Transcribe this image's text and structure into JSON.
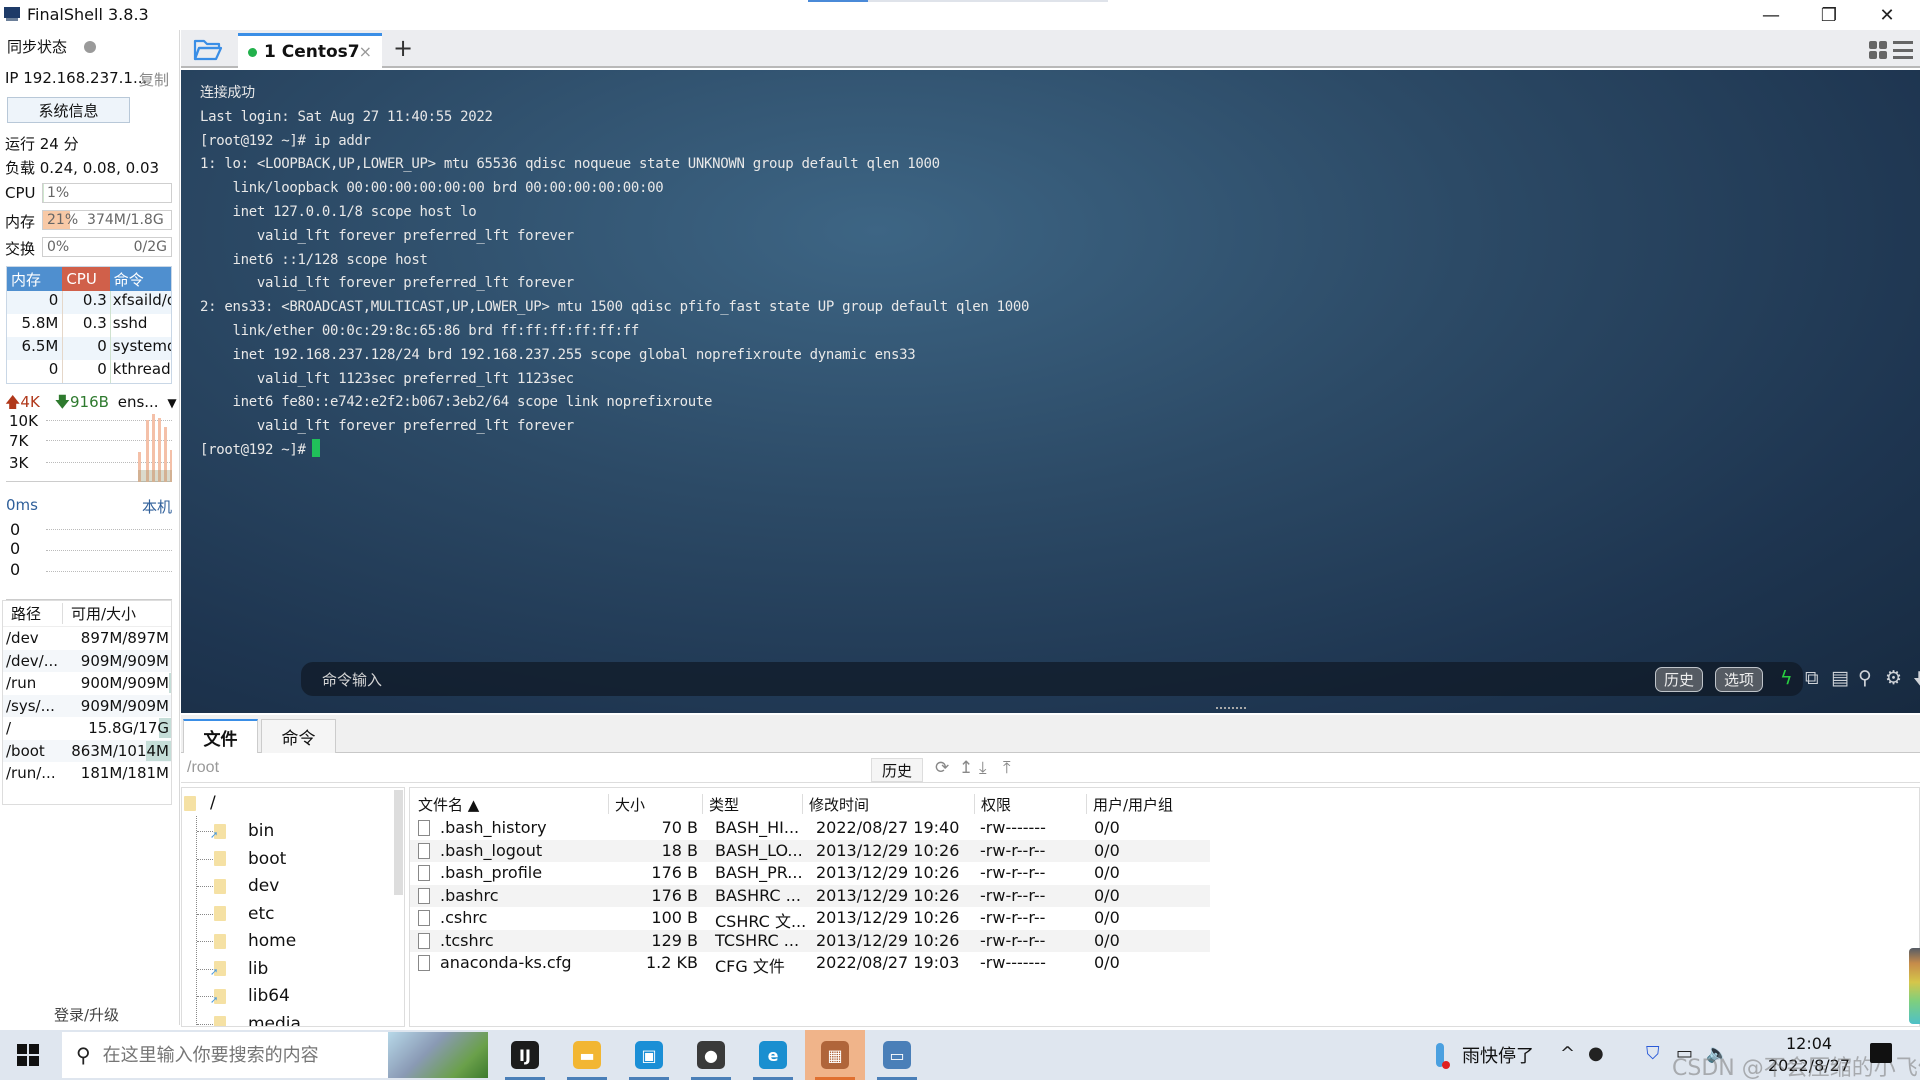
{
  "window": {
    "title": "FinalShell 3.8.3",
    "controls": {
      "minimize": "—",
      "maximize": "❐",
      "close": "✕"
    }
  },
  "sidebar": {
    "sync_label": "同步状态",
    "ip_label": "IP 192.168.237.1...",
    "copy_label": "复制",
    "sysinfo_button": "系统信息",
    "uptime": "运行 24 分",
    "load": "负载 0.24, 0.08, 0.03",
    "cpu": {
      "label": "CPU",
      "value": "1%",
      "percent": 1
    },
    "memory": {
      "label": "内存",
      "value": "21%",
      "detail": "374M/1.8G",
      "percent": 21
    },
    "swap": {
      "label": "交换",
      "value": "0%",
      "detail": "0/2G",
      "percent": 0
    },
    "process_table": {
      "headers": {
        "mem": "内存",
        "cpu": "CPU",
        "cmd": "命令"
      },
      "header_colors": {
        "mem": "#4f8fcf",
        "cpu": "#d0604a",
        "cmd": "#4f8fcf"
      },
      "rows": [
        {
          "mem": "0",
          "cpu": "0.3",
          "cmd": "xfsaild/d"
        },
        {
          "mem": "5.8M",
          "cpu": "0.3",
          "cmd": "sshd"
        },
        {
          "mem": "6.5M",
          "cpu": "0",
          "cmd": "systemd"
        },
        {
          "mem": "0",
          "cpu": "0",
          "cmd": "kthreadd"
        }
      ]
    },
    "network": {
      "upload": "4K",
      "download": "916B",
      "interface": "ens...",
      "ticks": [
        "10K",
        "7K",
        "3K"
      ]
    },
    "ping": {
      "latency": "0ms",
      "host": "本机",
      "values": [
        "0",
        "0",
        "0"
      ]
    },
    "disks": {
      "headers": {
        "path": "路径",
        "size": "可用/大小"
      },
      "rows": [
        {
          "path": "/dev",
          "size": "897M/897M",
          "used_percent": 0
        },
        {
          "path": "/dev/...",
          "size": "909M/909M",
          "used_percent": 0
        },
        {
          "path": "/run",
          "size": "900M/909M",
          "used_percent": 1
        },
        {
          "path": "/sys/...",
          "size": "909M/909M",
          "used_percent": 0
        },
        {
          "path": "/",
          "size": "15.8G/17G",
          "used_percent": 7
        },
        {
          "path": "/boot",
          "size": "863M/1014M",
          "used_percent": 15
        },
        {
          "path": "/run/...",
          "size": "181M/181M",
          "used_percent": 0
        }
      ]
    },
    "login_upgrade": "登录/升级"
  },
  "tabs": {
    "session": {
      "label": "1 Centos7",
      "status_color": "#22b14c",
      "close": "×"
    },
    "add": "+"
  },
  "terminal": {
    "lines": [
      "连接成功",
      "Last login: Sat Aug 27 11:40:55 2022",
      "[root@192 ~]# ip addr",
      "1: lo: <LOOPBACK,UP,LOWER_UP> mtu 65536 qdisc noqueue state UNKNOWN group default qlen 1000",
      "    link/loopback 00:00:00:00:00:00 brd 00:00:00:00:00:00",
      "    inet 127.0.0.1/8 scope host lo",
      "       valid_lft forever preferred_lft forever",
      "    inet6 ::1/128 scope host",
      "       valid_lft forever preferred_lft forever",
      "2: ens33: <BROADCAST,MULTICAST,UP,LOWER_UP> mtu 1500 qdisc pfifo_fast state UP group default qlen 1000",
      "    link/ether 00:0c:29:8c:65:86 brd ff:ff:ff:ff:ff:ff",
      "    inet 192.168.237.128/24 brd 192.168.237.255 scope global noprefixroute dynamic ens33",
      "       valid_lft 1123sec preferred_lft 1123sec",
      "    inet6 fe80::e742:e2f2:b067:3eb2/64 scope link noprefixroute",
      "       valid_lft forever preferred_lft forever"
    ],
    "prompt": "[root@192 ~]#",
    "command_input_placeholder": "命令输入",
    "history_button": "历史",
    "options_button": "选项"
  },
  "bottom_panel": {
    "tabs": [
      "文件",
      "命令"
    ],
    "path": "/root",
    "history_button": "历史",
    "tree": {
      "root": "/",
      "items": [
        {
          "name": "bin",
          "symlink": true
        },
        {
          "name": "boot",
          "symlink": false
        },
        {
          "name": "dev",
          "symlink": false
        },
        {
          "name": "etc",
          "symlink": false
        },
        {
          "name": "home",
          "symlink": false
        },
        {
          "name": "lib",
          "symlink": true
        },
        {
          "name": "lib64",
          "symlink": true
        },
        {
          "name": "media",
          "symlink": false
        }
      ]
    },
    "file_headers": {
      "name": "文件名 ▲",
      "size": "大小",
      "type": "类型",
      "modified": "修改时间",
      "perms": "权限",
      "owner": "用户/用户组"
    },
    "files": [
      {
        "name": ".bash_history",
        "size": "70 B",
        "type": "BASH_HI...",
        "modified": "2022/08/27 19:40",
        "perms": "-rw-------",
        "owner": "0/0"
      },
      {
        "name": ".bash_logout",
        "size": "18 B",
        "type": "BASH_LO...",
        "modified": "2013/12/29 10:26",
        "perms": "-rw-r--r--",
        "owner": "0/0"
      },
      {
        "name": ".bash_profile",
        "size": "176 B",
        "type": "BASH_PR...",
        "modified": "2013/12/29 10:26",
        "perms": "-rw-r--r--",
        "owner": "0/0"
      },
      {
        "name": ".bashrc",
        "size": "176 B",
        "type": "BASHRC ...",
        "modified": "2013/12/29 10:26",
        "perms": "-rw-r--r--",
        "owner": "0/0"
      },
      {
        "name": ".cshrc",
        "size": "100 B",
        "type": "CSHRC 文...",
        "modified": "2013/12/29 10:26",
        "perms": "-rw-r--r--",
        "owner": "0/0"
      },
      {
        "name": ".tcshrc",
        "size": "129 B",
        "type": "TCSHRC ...",
        "modified": "2013/12/29 10:26",
        "perms": "-rw-r--r--",
        "owner": "0/0"
      },
      {
        "name": "anaconda-ks.cfg",
        "size": "1.2 KB",
        "type": "CFG 文件",
        "modified": "2022/08/27 19:03",
        "perms": "-rw-------",
        "owner": "0/0"
      }
    ]
  },
  "taskbar": {
    "search_placeholder": "在这里输入你要搜索的内容",
    "apps": [
      {
        "name": "intellij-idea",
        "glyph": "IJ",
        "color": "#1c1c1c"
      },
      {
        "name": "file-explorer",
        "glyph": "▬",
        "color": "#f2b632"
      },
      {
        "name": "vmware",
        "glyph": "▣",
        "color": "#1b8fd6"
      },
      {
        "name": "user-avatar-app",
        "glyph": "●",
        "color": "#3a3a3a"
      },
      {
        "name": "edge-browser",
        "glyph": "e",
        "color": "#1a8fd0"
      },
      {
        "name": "finalshell",
        "glyph": "▦",
        "color": "#b0653a"
      },
      {
        "name": "remote-desktop",
        "glyph": "▭",
        "color": "#4a7fb8"
      }
    ],
    "weather": "雨快停了",
    "time": "12:04",
    "date": "2022/8/27",
    "watermark": "CSDN @不会压缩的小飞侠"
  }
}
